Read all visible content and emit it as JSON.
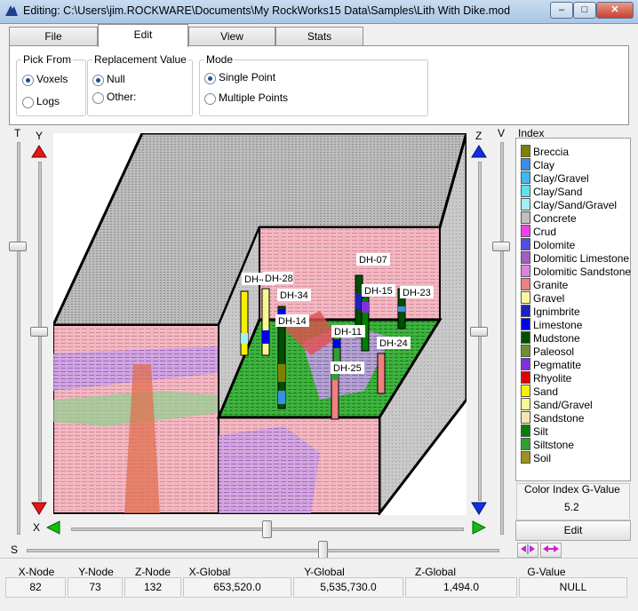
{
  "window": {
    "title": "Editing: C:\\Users\\jim.ROCKWARE\\Documents\\My RockWorks15 Data\\Samples\\Lith With Dike.mod"
  },
  "tabs": [
    "File",
    "Edit",
    "View",
    "Stats"
  ],
  "edit_panel": {
    "pick_from": {
      "label": "Pick From",
      "options": [
        "Voxels",
        "Logs"
      ],
      "selected": "Voxels"
    },
    "replacement": {
      "label": "Replacement Value",
      "options": [
        "Null",
        "Other:"
      ],
      "selected": "Null"
    },
    "mode": {
      "label": "Mode",
      "options": [
        "Single Point",
        "Multiple Points"
      ],
      "selected": "Single Point"
    }
  },
  "axes": {
    "t": "T",
    "y": "Y",
    "z": "Z",
    "v": "V",
    "x": "X",
    "s": "S"
  },
  "boreholes": [
    "DH-42",
    "DH-28",
    "DH-34",
    "DH-14",
    "DH-07",
    "DH-15",
    "DH-23",
    "DH-11",
    "DH-24",
    "DH-25"
  ],
  "index": {
    "title": "Index",
    "items": [
      {
        "label": "Breccia",
        "color": "#808000"
      },
      {
        "label": "Clay",
        "color": "#3a8ee6"
      },
      {
        "label": "Clay/Gravel",
        "color": "#40b8f0"
      },
      {
        "label": "Clay/Sand",
        "color": "#60e0f0"
      },
      {
        "label": "Clay/Sand/Gravel",
        "color": "#a0f0f8"
      },
      {
        "label": "Concrete",
        "color": "#c0c0c0"
      },
      {
        "label": "Crud",
        "color": "#f040f0"
      },
      {
        "label": "Dolomite",
        "color": "#5050e0"
      },
      {
        "label": "Dolomitic Limestone",
        "color": "#a060c0"
      },
      {
        "label": "Dolomitic Sandstone",
        "color": "#e080e0"
      },
      {
        "label": "Granite",
        "color": "#f08080"
      },
      {
        "label": "Gravel",
        "color": "#f8f8a0"
      },
      {
        "label": "Ignimbrite",
        "color": "#2020c0"
      },
      {
        "label": "Limestone",
        "color": "#0000f0"
      },
      {
        "label": "Mudstone",
        "color": "#005000"
      },
      {
        "label": "Paleosol",
        "color": "#709030"
      },
      {
        "label": "Pegmatite",
        "color": "#8030e0"
      },
      {
        "label": "Rhyolite",
        "color": "#e00000"
      },
      {
        "label": "Sand",
        "color": "#f8f000"
      },
      {
        "label": "Sand/Gravel",
        "color": "#f8f890"
      },
      {
        "label": "Sandstone",
        "color": "#f0e8b0"
      },
      {
        "label": "Silt",
        "color": "#008000"
      },
      {
        "label": "Siltstone",
        "color": "#30a030"
      },
      {
        "label": "Soil",
        "color": "#a09020"
      }
    ]
  },
  "color_index": {
    "label": "Color Index G-Value",
    "value": "5.2",
    "edit_label": "Edit"
  },
  "status": {
    "headers": [
      "X-Node",
      "Y-Node",
      "Z-Node",
      "X-Global",
      "Y-Global",
      "Z-Global",
      "G-Value"
    ],
    "values": [
      "82",
      "73",
      "132",
      "653,520.0",
      "5,535,730.0",
      "1,494.0",
      "NULL"
    ]
  }
}
